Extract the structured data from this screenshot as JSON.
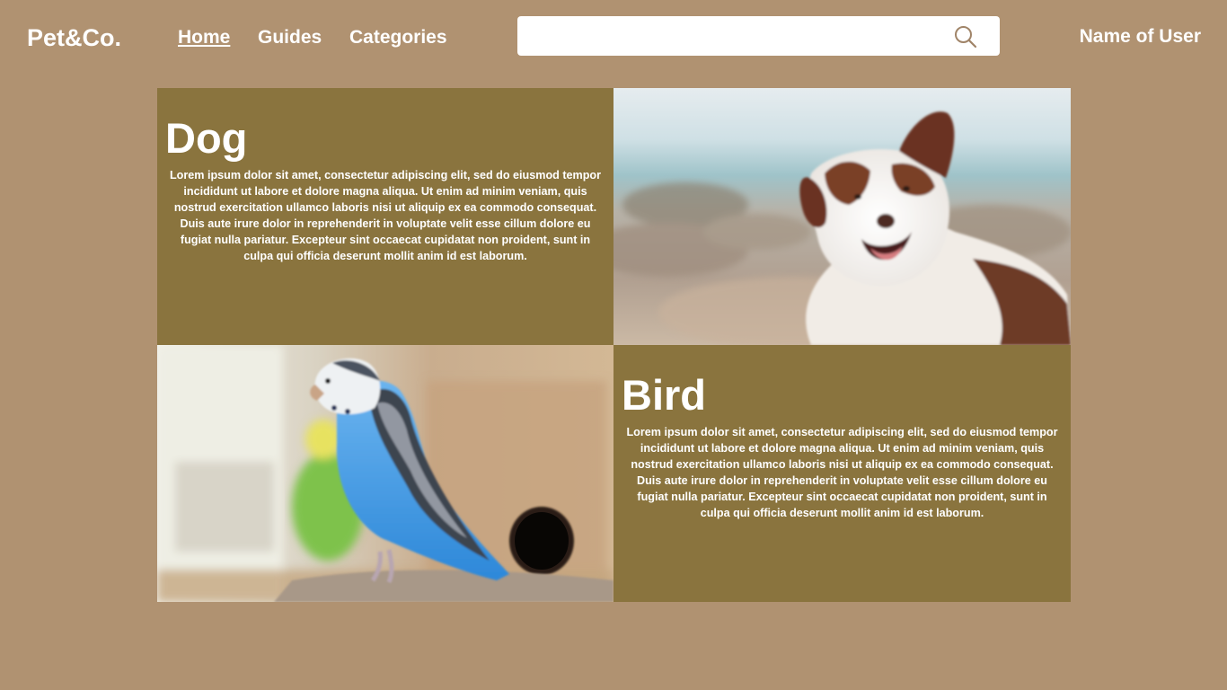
{
  "header": {
    "logo": "Pet&Co.",
    "nav": [
      {
        "label": "Home",
        "active": true
      },
      {
        "label": "Guides"
      },
      {
        "label": "Categories"
      }
    ],
    "search": {
      "value": "",
      "placeholder": "",
      "icon": "search-icon"
    },
    "user_name": "Name of User"
  },
  "cards": [
    {
      "title": "Dog",
      "body": "Lorem ipsum dolor sit amet, consectetur adipiscing elit, sed do eiusmod tempor incididunt ut labore et dolore magna aliqua. Ut enim ad minim veniam, quis nostrud exercitation ullamco laboris nisi ut aliquip ex ea commodo consequat. Duis aute irure dolor in reprehenderit in voluptate velit esse cillum dolore eu fugiat nulla pariatur. Excepteur sint occaecat cupidatat non proident, sunt in culpa qui officia deserunt mollit anim id est laborum."
    },
    {
      "title": "Bird",
      "body": "Lorem ipsum dolor sit amet, consectetur adipiscing elit, sed do eiusmod tempor incididunt ut labore et dolore magna aliqua. Ut enim ad minim veniam, quis nostrud exercitation ullamco laboris nisi ut aliquip ex ea commodo consequat. Duis aute irure dolor in reprehenderit in voluptate velit esse cillum dolore eu fugiat nulla pariatur. Excepteur sint occaecat cupidatat non proident, sunt in culpa qui officia deserunt mollit anim id est laborum."
    }
  ],
  "colors": {
    "page_background": "#b09271",
    "card_background": "#8a743e",
    "text": "#ffffff"
  }
}
